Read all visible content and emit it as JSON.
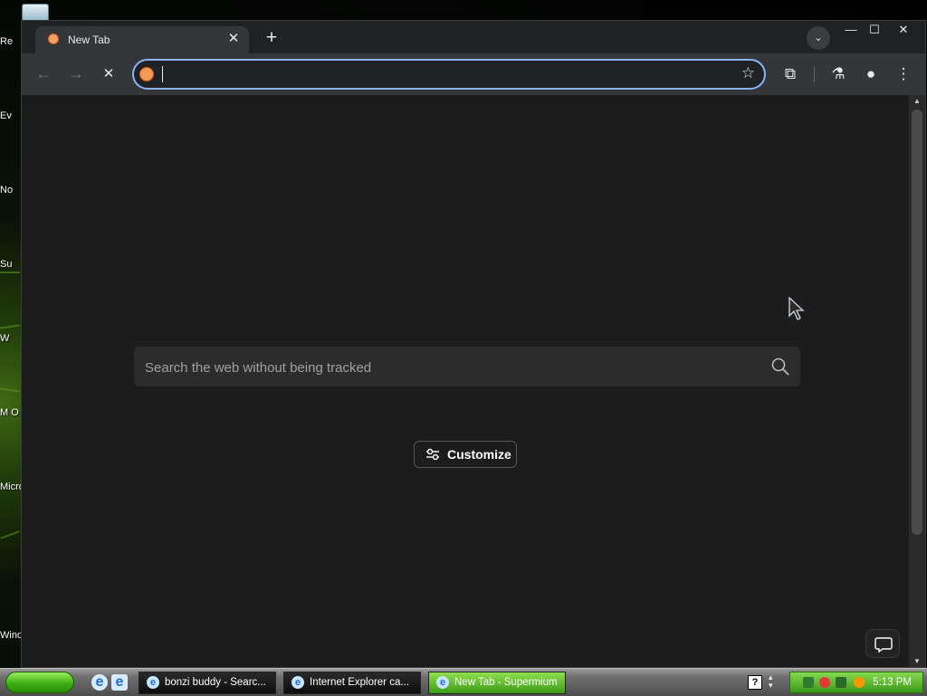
{
  "desktop": {
    "icons": [
      "Re",
      "Ev",
      "No",
      "Su",
      "W",
      "M O",
      "Micro Stu",
      "Wind"
    ]
  },
  "browser": {
    "tab": {
      "title": "New Tab",
      "close": "✕"
    },
    "new_tab_glyph": "+",
    "tab_search_glyph": "⌄",
    "window_controls": {
      "minimize": "—",
      "maximize": "☐",
      "close": "✕"
    },
    "toolbar": {
      "back": "←",
      "forward": "→",
      "stop": "✕",
      "bookmark": "☆",
      "extensions": "⧉",
      "labs": "⚗",
      "profile": "●",
      "menu": "⋮"
    },
    "omnibox": {
      "value": "",
      "placeholder": ""
    },
    "page": {
      "search_placeholder": "Search the web without being tracked",
      "customize_label": "Customize"
    }
  },
  "taskbar": {
    "buttons": [
      {
        "label": "bonzi buddy - Searc..."
      },
      {
        "label": "Internet Explorer ca..."
      },
      {
        "label": "New Tab - Supermium"
      }
    ],
    "help": "?",
    "clock": "5:13 PM"
  },
  "colors": {
    "omnibox_focus": "#8ab4f8",
    "page_bg": "#1c1c1c",
    "taskbar_active": "#5cbf26"
  }
}
